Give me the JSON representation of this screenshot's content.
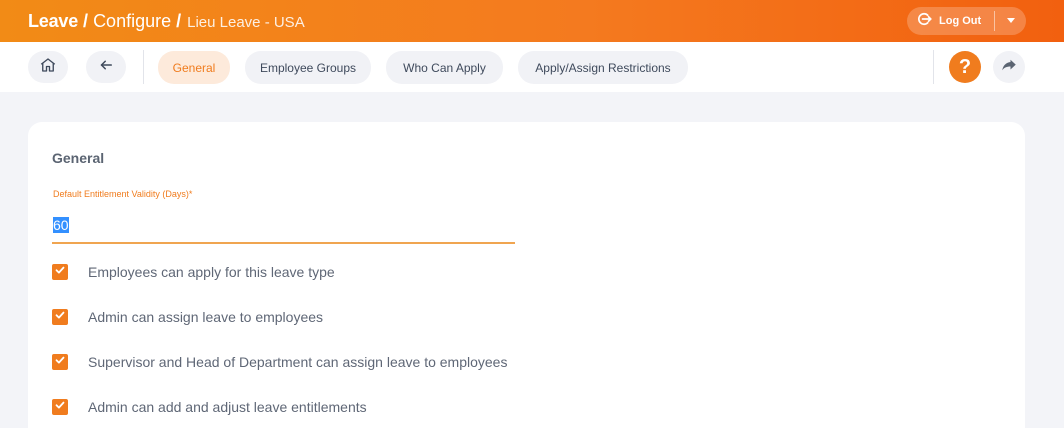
{
  "header": {
    "breadcrumb": {
      "module": "Leave",
      "section": "Configure",
      "page": "Lieu Leave - USA",
      "separator": "/"
    },
    "logout_label": "Log Out",
    "accent_gradient": [
      "#f28b16",
      "#f2600f"
    ]
  },
  "toolbar": {
    "icons": {
      "home": "home-icon",
      "back": "arrow-left-icon",
      "help": "question-icon",
      "share": "share-icon"
    },
    "help_glyph": "?",
    "tabs": [
      {
        "label": "General",
        "active": true
      },
      {
        "label": "Employee Groups",
        "active": false
      },
      {
        "label": "Who Can Apply",
        "active": false
      },
      {
        "label": "Apply/Assign Restrictions",
        "active": false
      }
    ]
  },
  "form": {
    "section_title": "General",
    "entitlement_field": {
      "label": "Default Entitlement Validity (Days)",
      "required_marker": "*",
      "value": "60"
    },
    "checkboxes": [
      {
        "label": "Employees can apply for this leave type",
        "checked": true
      },
      {
        "label": "Admin can assign leave to employees",
        "checked": true
      },
      {
        "label": "Supervisor and Head of Department can assign leave to employees",
        "checked": true
      },
      {
        "label": "Admin can add and adjust leave entitlements",
        "checked": true
      }
    ]
  },
  "colors": {
    "accent": "#f07c1e",
    "background": "#f3f4f8",
    "text": "#5f6776"
  }
}
